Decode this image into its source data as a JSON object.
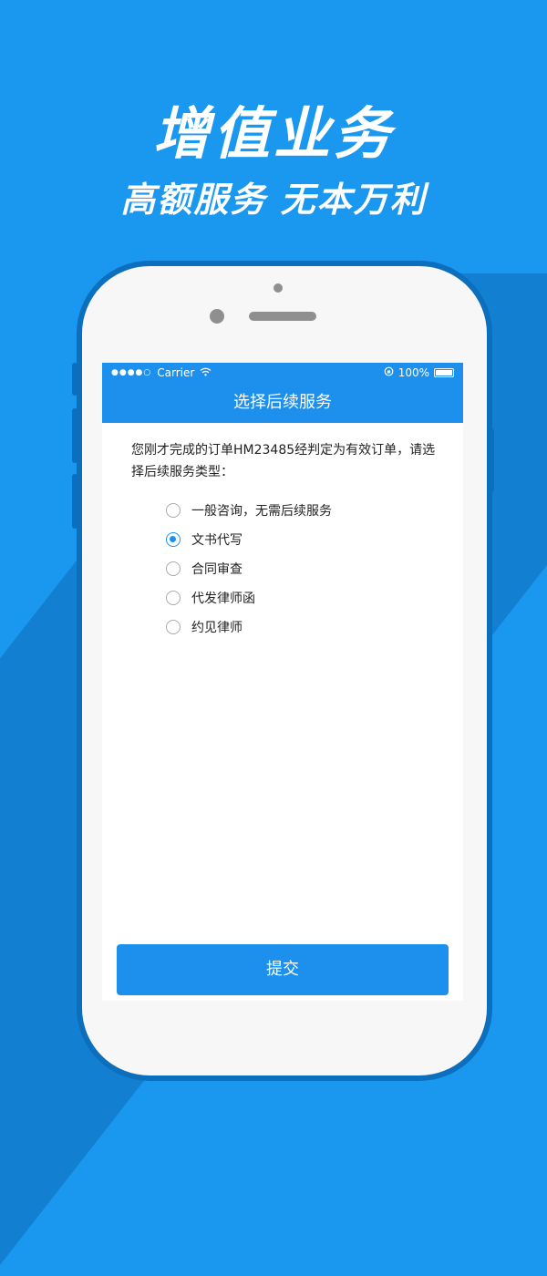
{
  "promo": {
    "headline": "增值业务",
    "subheadline": "高额服务 无本万利"
  },
  "status_bar": {
    "carrier": "Carrier",
    "battery": "100%"
  },
  "nav": {
    "title": "选择后续服务"
  },
  "content": {
    "description": "您刚才完成的订单HM23485经判定为有效订单，请选择后续服务类型：",
    "options": [
      {
        "label": "一般咨询，无需后续服务",
        "selected": false
      },
      {
        "label": "文书代写",
        "selected": true
      },
      {
        "label": "合同审查",
        "selected": false
      },
      {
        "label": "代发律师函",
        "selected": false
      },
      {
        "label": "约见律师",
        "selected": false
      }
    ],
    "submit_label": "提交"
  },
  "colors": {
    "background": "#1a98f0",
    "accent": "#1d90ee"
  }
}
